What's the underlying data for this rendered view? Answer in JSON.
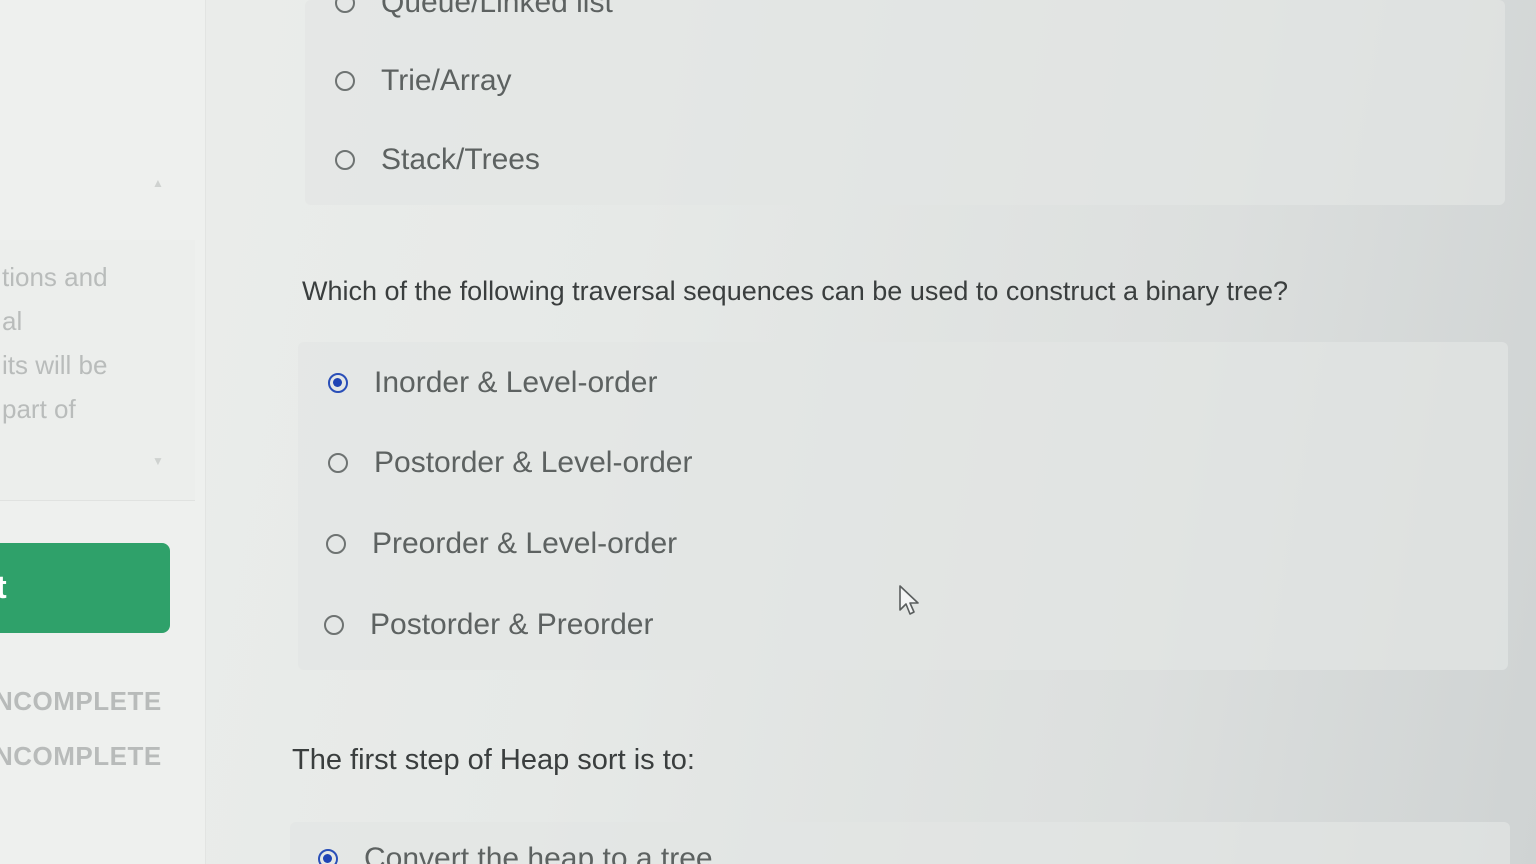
{
  "sidebar": {
    "description_lines": [
      "tions and",
      "al",
      "its will be",
      "part of"
    ],
    "start_button_label": "t",
    "statuses": [
      "NCOMPLETE",
      "NCOMPLETE"
    ]
  },
  "questions": [
    {
      "text": "",
      "options": [
        {
          "label": "Queue/Linked list",
          "selected": false
        },
        {
          "label": "Trie/Array",
          "selected": false
        },
        {
          "label": "Stack/Trees",
          "selected": false
        }
      ]
    },
    {
      "text": "Which of the following traversal sequences can be used to construct a binary tree?",
      "options": [
        {
          "label": "Inorder & Level-order",
          "selected": true
        },
        {
          "label": "Postorder & Level-order",
          "selected": false
        },
        {
          "label": "Preorder & Level-order",
          "selected": false
        },
        {
          "label": "Postorder & Preorder",
          "selected": false
        }
      ]
    },
    {
      "text": "The first step of Heap sort is to:",
      "options": [
        {
          "label": "Convert the heap to a tree",
          "selected": true
        }
      ]
    }
  ],
  "colors": {
    "accent_green": "#2fa16a",
    "radio_selected": "#1f44b5"
  },
  "icons": [
    "scroll-up-icon",
    "scroll-down-icon",
    "radio-icon",
    "mouse-cursor-icon"
  ]
}
